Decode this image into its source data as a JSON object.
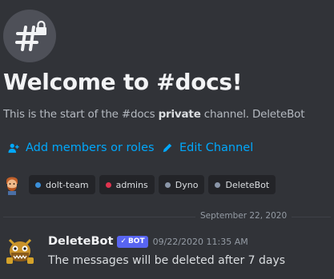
{
  "channel": {
    "icon": "hashtag-lock-icon",
    "welcome_title": "Welcome to #docs!",
    "description_start": "This is the start of the #docs ",
    "description_bold": "private",
    "description_end": " channel. DeleteBot"
  },
  "actions": [
    {
      "label": "Add members or roles",
      "icon": "add-user-icon"
    },
    {
      "label": "Edit Channel",
      "icon": "pencil-icon"
    }
  ],
  "roles": [
    {
      "name": "dolt-team",
      "color": "#3b8fd9"
    },
    {
      "name": "admins",
      "color": "#e0344f"
    },
    {
      "name": "Dyno",
      "color": "#8a96a8"
    },
    {
      "name": "DeleteBot",
      "color": "#8a96a8"
    }
  ],
  "divider": {
    "date": "September 22, 2020"
  },
  "message": {
    "author": "DeleteBot",
    "bot_tag": "BOT",
    "timestamp": "09/22/2020 11:35 AM",
    "content": "The messages will be deleted after 7 days"
  },
  "colors": {
    "background": "#313338",
    "link": "#00a8fc",
    "bot_tag": "#5865f2",
    "muted_text": "#b5bac1"
  }
}
